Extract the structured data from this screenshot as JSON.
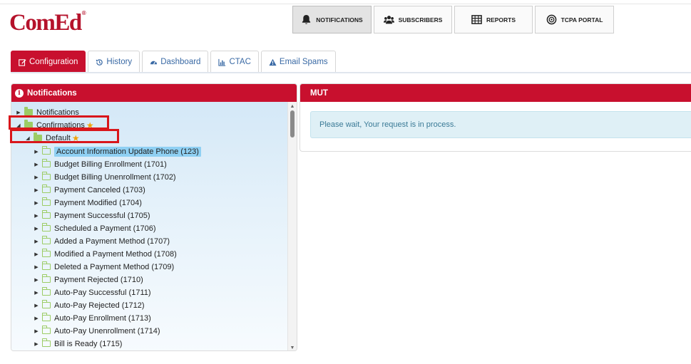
{
  "logo": {
    "text": "ComEd",
    "mark": "®"
  },
  "topnav": [
    {
      "label": "NOTIFICATIONS",
      "icon": "bell-icon",
      "active": true
    },
    {
      "label": "SUBSCRIBERS",
      "icon": "users-icon",
      "active": false
    },
    {
      "label": "REPORTS",
      "icon": "table-icon",
      "active": false
    },
    {
      "label": "TCPA PORTAL",
      "icon": "target-icon",
      "active": false
    }
  ],
  "tabs": [
    {
      "label": "Configuration",
      "icon": "edit-icon",
      "active": true
    },
    {
      "label": "History",
      "icon": "history-icon",
      "active": false
    },
    {
      "label": "Dashboard",
      "icon": "dashboard-icon",
      "active": false
    },
    {
      "label": "CTAC",
      "icon": "chart-icon",
      "active": false
    },
    {
      "label": "Email Spams",
      "icon": "warning-icon",
      "active": false
    }
  ],
  "left_panel": {
    "title": "Notifications"
  },
  "tree": {
    "root": "Notifications",
    "group": "Confirmations",
    "subgroup": "Default",
    "items": [
      "Account Information Update Phone (123)",
      "Budget Billing Enrollment (1701)",
      "Budget Billing Unenrollment (1702)",
      "Payment Canceled (1703)",
      "Payment Modified (1704)",
      "Payment Successful (1705)",
      "Scheduled a Payment (1706)",
      "Added a Payment Method (1707)",
      "Modified a Payment Method (1708)",
      "Deleted a Payment Method (1709)",
      "Payment Rejected (1710)",
      "Auto-Pay Successful (1711)",
      "Auto-Pay Rejected (1712)",
      "Auto-Pay Enrollment (1713)",
      "Auto-Pay Unenrollment (1714)",
      "Bill is Ready (1715)"
    ]
  },
  "right_panel": {
    "title": "MUT",
    "message": "Please wait, Your request is in process."
  },
  "colors": {
    "brand": "#c8102e",
    "link": "#3a6aa5",
    "folder": "#9ccc65",
    "star": "#f0a30a",
    "highlight": "#d9161b"
  }
}
